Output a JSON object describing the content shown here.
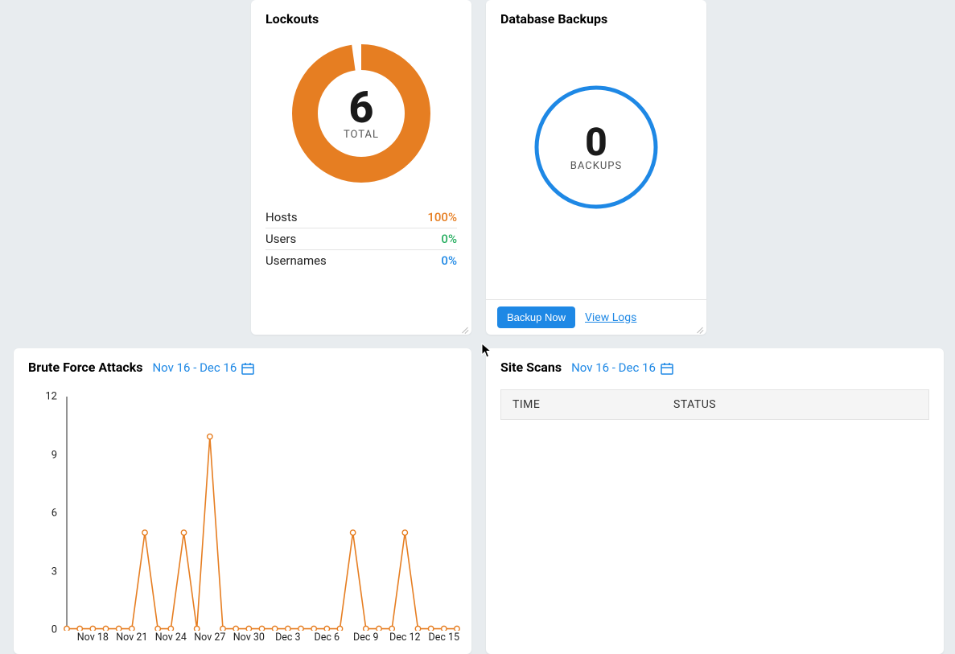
{
  "lockouts": {
    "title": "Lockouts",
    "total_value": "6",
    "total_label": "TOTAL",
    "donut_color": "#e67e22",
    "rows": [
      {
        "label": "Hosts",
        "value": "100%",
        "class": "val-orange"
      },
      {
        "label": "Users",
        "value": "0%",
        "class": "val-green"
      },
      {
        "label": "Usernames",
        "value": "0%",
        "class": "val-blue"
      }
    ]
  },
  "backups": {
    "title": "Database Backups",
    "value": "0",
    "label": "BACKUPS",
    "circle_color": "#1e88e5",
    "backup_now_label": "Backup Now",
    "view_logs_label": "View Logs"
  },
  "bruteforce": {
    "title": "Brute Force Attacks",
    "date_range": "Nov 16 - Dec 16"
  },
  "sitescans": {
    "title": "Site Scans",
    "date_range": "Nov 16 - Dec 16",
    "col_time": "TIME",
    "col_status": "STATUS"
  },
  "chart_data": {
    "type": "line",
    "title": "Brute Force Attacks",
    "xlabel": "",
    "ylabel": "",
    "ylim": [
      0,
      12
    ],
    "y_ticks": [
      0,
      3,
      6,
      9,
      12
    ],
    "x_tick_labels": [
      "Nov 18",
      "Nov 21",
      "Nov 24",
      "Nov 27",
      "Nov 30",
      "Dec 3",
      "Dec 6",
      "Dec 9",
      "Dec 12",
      "Dec 15"
    ],
    "categories": [
      "Nov 16",
      "Nov 17",
      "Nov 18",
      "Nov 19",
      "Nov 20",
      "Nov 21",
      "Nov 22",
      "Nov 23",
      "Nov 24",
      "Nov 25",
      "Nov 26",
      "Nov 27",
      "Nov 28",
      "Nov 29",
      "Nov 30",
      "Dec 1",
      "Dec 2",
      "Dec 3",
      "Dec 4",
      "Dec 5",
      "Dec 6",
      "Dec 7",
      "Dec 8",
      "Dec 9",
      "Dec 10",
      "Dec 11",
      "Dec 12",
      "Dec 13",
      "Dec 14",
      "Dec 15",
      "Dec 16"
    ],
    "values": [
      0,
      0,
      0,
      0,
      0,
      0,
      5,
      0,
      0,
      5,
      0,
      10,
      0,
      0,
      0,
      0,
      0,
      0,
      0,
      0,
      0,
      0,
      5,
      0,
      0,
      0,
      5,
      0,
      0,
      0,
      0
    ],
    "line_color": "#e67e22"
  }
}
